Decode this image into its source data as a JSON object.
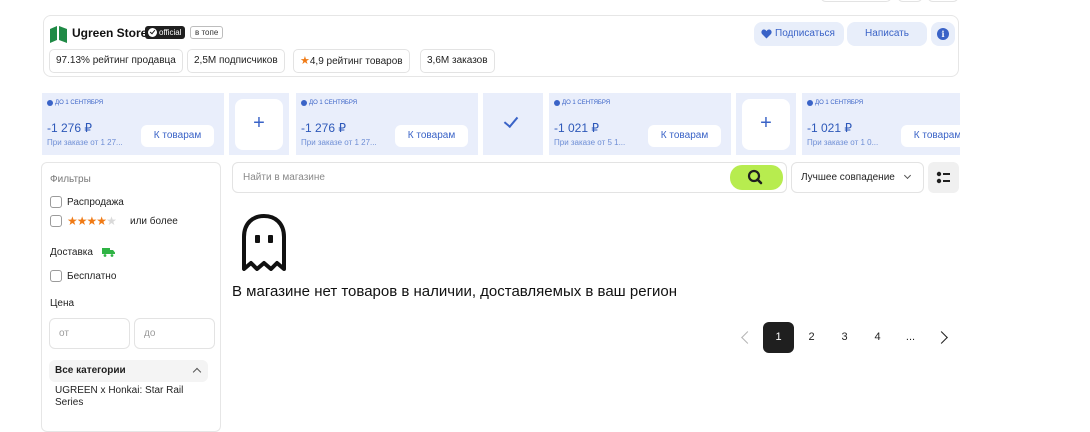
{
  "store": {
    "name": "Ugreen Store",
    "official_badge": "official",
    "top_badge": "в топе",
    "stats": {
      "rating_seller": "97.13% рейтинг продавца",
      "subscribers": "2,5M подписчиков",
      "rating_goods": "4,9 рейтинг товаров",
      "orders": "3,6M заказов"
    },
    "subscribe_label": "Подписаться",
    "write_label": "Написать",
    "info_label": "i"
  },
  "promos": [
    {
      "date": "ДО 1 СЕНТЯБРЯ",
      "price": "-1 276 ₽",
      "condition": "При заказе от 1 27...",
      "button": "К товарам"
    },
    {
      "date": "ДО 1 СЕНТЯБРЯ",
      "price": "-1 276 ₽",
      "condition": "При заказе от 1 27...",
      "button": "К товарам"
    },
    {
      "date": "ДО 1 СЕНТЯБРЯ",
      "price": "-1 021 ₽",
      "condition": "При заказе от 5 1...",
      "button": "К товарам"
    },
    {
      "date": "ДО 1 СЕНТЯБРЯ",
      "price": "-1 021 ₽",
      "condition": "При заказе от 1 0...",
      "button": "К товарам"
    }
  ],
  "promo_join": [
    "+",
    "✓",
    "+"
  ],
  "filters": {
    "title": "Фильтры",
    "sale": "Распродажа",
    "rating_suffix": "или более",
    "rating_stars": 4,
    "delivery_title": "Доставка",
    "free": "Бесплатно",
    "price_title": "Цена",
    "price_from": "от",
    "price_to": "до",
    "categories_title": "Все категории",
    "category_first": "UGREEN x Honkai: Star Rail Series"
  },
  "search": {
    "placeholder": "Найти в магазине",
    "sort_label": "Лучшее совпадение"
  },
  "empty_message": "В магазине нет товаров в наличии, доставляемых в ваш регион",
  "pagination": {
    "pages": [
      "1",
      "2",
      "3",
      "4",
      "..."
    ],
    "current": "1"
  },
  "colors": {
    "accent_blue": "#3a63c7",
    "promo_bg": "#e9eefb",
    "search_button": "#b7ec4f",
    "star": "#f07b16",
    "delivery_green": "#2fb344"
  }
}
